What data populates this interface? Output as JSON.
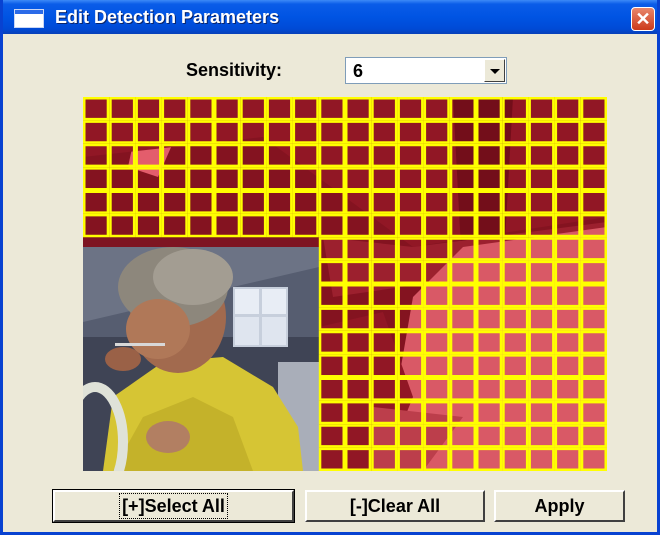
{
  "window": {
    "title": "Edit Detection Parameters",
    "icon": "window-icon",
    "close_glyph": "✕"
  },
  "sensitivity": {
    "label": "Sensitivity:",
    "value": "6"
  },
  "buttons": {
    "select_all": "[+]Select All",
    "clear_all": "[-]Clear All",
    "apply": "Apply"
  },
  "colors": {
    "title_bar": "#0054e3",
    "dialog_bg": "#ece9d8",
    "grid_line": "#ffff00",
    "mask_tint": "#b0142a"
  },
  "grid": {
    "columns": 20,
    "rows": 16,
    "unselected_region": "cols 0-8, rows 6-15"
  }
}
